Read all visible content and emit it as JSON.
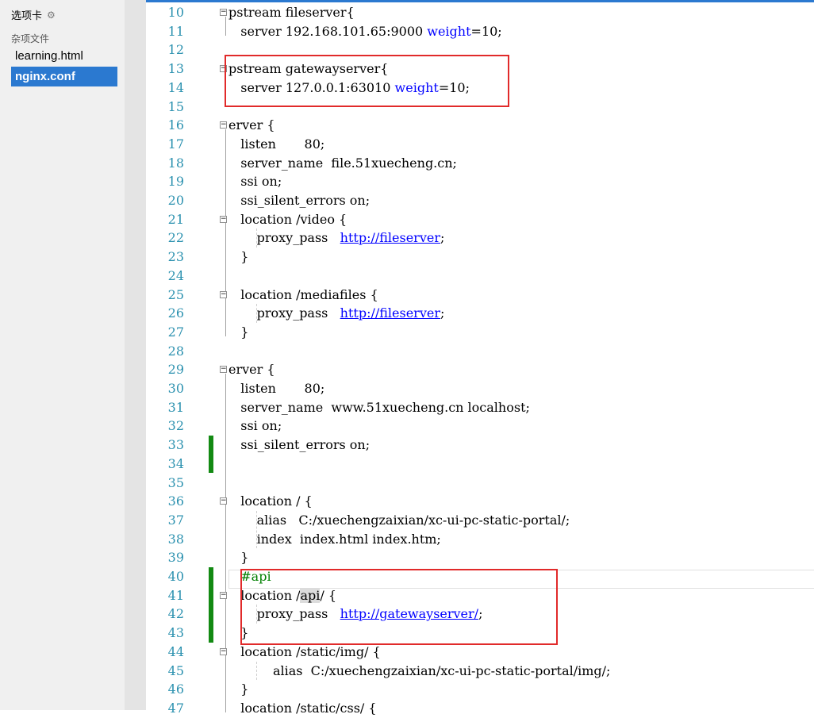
{
  "sidebar": {
    "header": "选项卡",
    "group_label": "杂项文件",
    "files": [
      {
        "name": "learning.html",
        "active": false
      },
      {
        "name": "nginx.conf",
        "active": true
      }
    ]
  },
  "editor": {
    "lines": [
      {
        "n": "10",
        "text": "pstream fileserver{"
      },
      {
        "n": "11",
        "text": "   server 192.168.101.65:9000 weight=10;"
      },
      {
        "n": "12",
        "text": ""
      },
      {
        "n": "13",
        "text": "pstream gatewayserver{"
      },
      {
        "n": "14",
        "text": "   server 127.0.0.1:63010 weight=10;"
      },
      {
        "n": "15",
        "text": ""
      },
      {
        "n": "16",
        "text": "erver {"
      },
      {
        "n": "17",
        "text": "   listen       80;"
      },
      {
        "n": "18",
        "text": "   server_name  file.51xuecheng.cn;"
      },
      {
        "n": "19",
        "text": "   ssi on;"
      },
      {
        "n": "20",
        "text": "   ssi_silent_errors on;"
      },
      {
        "n": "21",
        "text": "   location /video {"
      },
      {
        "n": "22",
        "text": "       proxy_pass   http://fileserver;"
      },
      {
        "n": "23",
        "text": "   }"
      },
      {
        "n": "24",
        "text": ""
      },
      {
        "n": "25",
        "text": "   location /mediafiles {"
      },
      {
        "n": "26",
        "text": "       proxy_pass   http://fileserver;"
      },
      {
        "n": "27",
        "text": "   }"
      },
      {
        "n": "28",
        "text": ""
      },
      {
        "n": "29",
        "text": "erver {"
      },
      {
        "n": "30",
        "text": "   listen       80;"
      },
      {
        "n": "31",
        "text": "   server_name  www.51xuecheng.cn localhost;"
      },
      {
        "n": "32",
        "text": "   ssi on;"
      },
      {
        "n": "33",
        "text": "   ssi_silent_errors on;"
      },
      {
        "n": "34",
        "text": ""
      },
      {
        "n": "35",
        "text": ""
      },
      {
        "n": "36",
        "text": "   location / {"
      },
      {
        "n": "37",
        "text": "       alias   C:/xuechengzaixian/xc-ui-pc-static-portal/;"
      },
      {
        "n": "38",
        "text": "       index  index.html index.htm;"
      },
      {
        "n": "39",
        "text": "   }"
      },
      {
        "n": "40",
        "text": "   #api"
      },
      {
        "n": "41",
        "text": "   location /api/ {"
      },
      {
        "n": "42",
        "text": "       proxy_pass   http://gatewayserver/;"
      },
      {
        "n": "43",
        "text": "   }"
      },
      {
        "n": "44",
        "text": "   location /static/img/ {"
      },
      {
        "n": "45",
        "text": "           alias  C:/xuechengzaixian/xc-ui-pc-static-portal/img/;"
      },
      {
        "n": "46",
        "text": "   }"
      },
      {
        "n": "47",
        "text": "   location /static/css/ {"
      }
    ]
  }
}
